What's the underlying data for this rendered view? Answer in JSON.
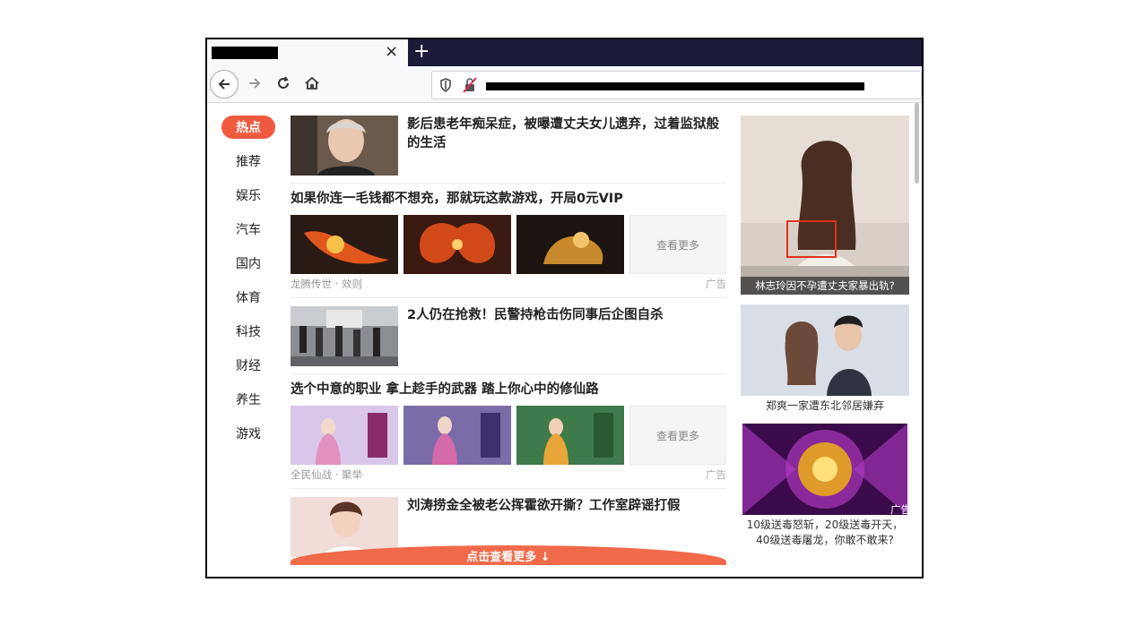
{
  "browser": {
    "tab_close": "×",
    "new_tab": "+",
    "back_icon": "arrow-left-icon",
    "forward_icon": "arrow-right-icon",
    "reload_icon": "reload-icon",
    "home_icon": "home-icon"
  },
  "sidebar": {
    "items": [
      {
        "label": "热点",
        "active": true
      },
      {
        "label": "推荐"
      },
      {
        "label": "娱乐"
      },
      {
        "label": "汽车"
      },
      {
        "label": "国内"
      },
      {
        "label": "体育"
      },
      {
        "label": "科技"
      },
      {
        "label": "财经"
      },
      {
        "label": "养生"
      },
      {
        "label": "游戏"
      }
    ]
  },
  "feed": {
    "item1": {
      "title": "影后患老年痴呆症，被曝遭丈夫女儿遗弃，过着监狱般的生活"
    },
    "ad1": {
      "title": "如果你连一毛钱都不想充，那就玩这款游戏，开局0元VIP",
      "more": "查看更多",
      "source": "龙腾传世 · 效则",
      "tag": "广告"
    },
    "item2": {
      "title": "2人仍在抢救！民警持枪击伤同事后企图自杀"
    },
    "ad2": {
      "title": "选个中意的职业 拿上趁手的武器 踏上你心中的修仙路",
      "more": "查看更多",
      "source": "全民仙战 · 聚举",
      "tag": "广告"
    },
    "item3": {
      "title": "刘涛捞金全被老公挥霍欲开撕？工作室辟谣打假"
    },
    "load_more": "点击查看更多 ↓"
  },
  "right": {
    "card1": {
      "caption": "林志玲因不孕遭丈夫家暴出轨?"
    },
    "card2": {
      "caption": "郑爽一家遭东北邻居嫌弃"
    },
    "card3": {
      "caption_line1": "10级送毒怒斩，20级送毒开天，",
      "caption_line2": "40级送毒屠龙，你敢不敢来?",
      "tag": "广告"
    }
  },
  "colors": {
    "accent": "#f05a3e",
    "tabstrip": "#1c1b3a"
  }
}
